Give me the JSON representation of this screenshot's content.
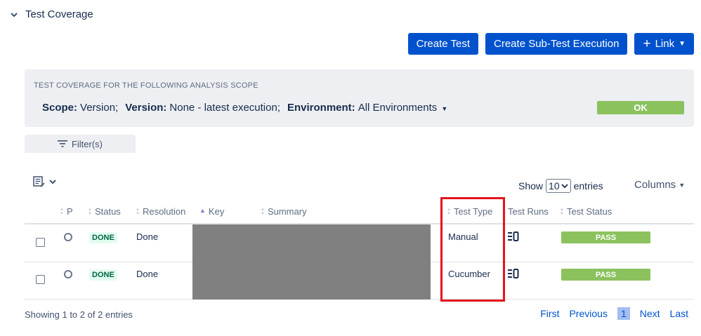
{
  "section": {
    "title": "Test Coverage"
  },
  "actions": {
    "create_test": "Create Test",
    "create_sub_test_execution": "Create Sub-Test Execution",
    "link": "Link"
  },
  "scope": {
    "heading": "TEST COVERAGE FOR THE FOLLOWING ANALYSIS SCOPE",
    "scope_label": "Scope:",
    "scope_value": "Version;",
    "version_label": "Version:",
    "version_value": "None - latest execution;",
    "environment_label": "Environment:",
    "environment_value": "All Environments",
    "status": "OK"
  },
  "filter": {
    "label": "Filter(s)"
  },
  "table_controls": {
    "show_label": "Show",
    "page_size": "10",
    "entries_label": "entries",
    "columns_label": "Columns"
  },
  "columns": {
    "p": "P",
    "status": "Status",
    "resolution": "Resolution",
    "key": "Key",
    "summary": "Summary",
    "test_type": "Test Type",
    "test_runs": "Test Runs",
    "test_status": "Test Status"
  },
  "rows": [
    {
      "status": "DONE",
      "resolution": "Done",
      "test_type": "Manual",
      "test_status": "PASS"
    },
    {
      "status": "DONE",
      "resolution": "Done",
      "test_type": "Cucumber",
      "test_status": "PASS"
    }
  ],
  "footer": {
    "info": "Showing 1 to 2 of 2 entries",
    "first": "First",
    "previous": "Previous",
    "current_page": "1",
    "next": "Next",
    "last": "Last"
  },
  "colors": {
    "primary": "#0052cc",
    "ok_green": "#8bc25e",
    "highlight_red": "#e3141c",
    "done_bg": "#e3fcef",
    "done_text": "#006644"
  },
  "icons": {
    "section_toggle": "chevron-down-icon",
    "link_plus": "plus-icon",
    "link_caret": "caret-down-icon",
    "filter": "filter-icon",
    "export": "export-icon",
    "test_runs": "test-runs-icon",
    "priority": "priority-circle-icon"
  }
}
